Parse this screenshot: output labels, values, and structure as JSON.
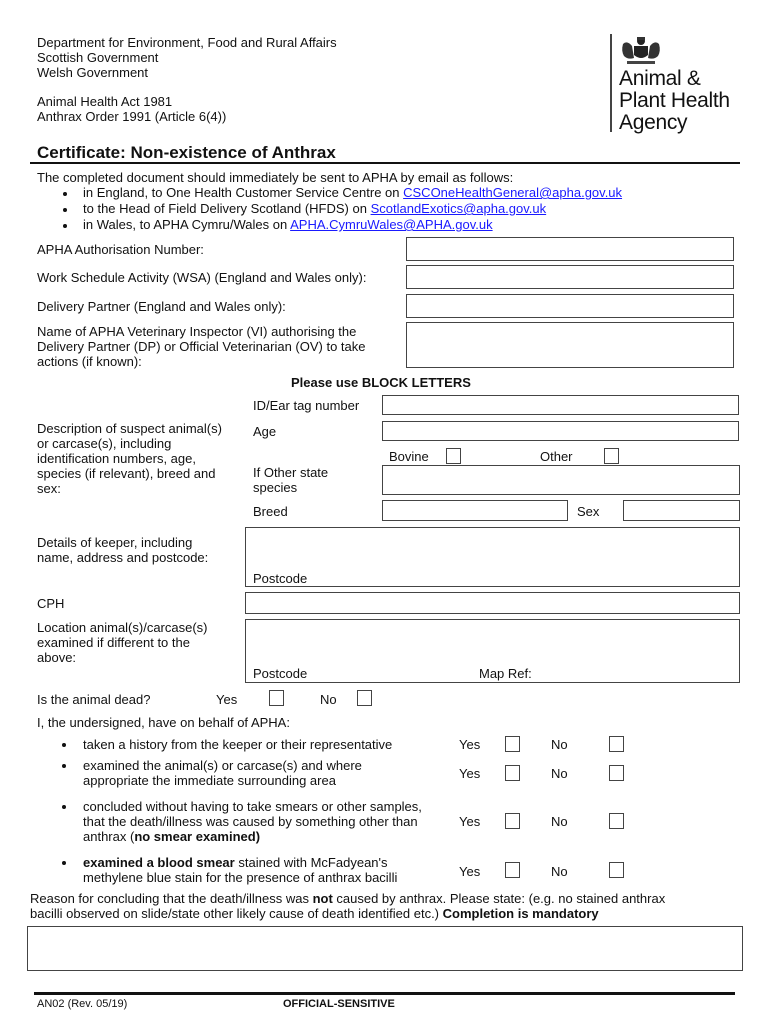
{
  "header": {
    "org_lines": [
      "Department for Environment, Food and Rural Affairs",
      "Scottish Government",
      "Welsh Government"
    ],
    "legislation_lines": [
      "Animal Health Act 1981",
      "Anthrax Order 1991 (Article 6(4))"
    ],
    "logo": {
      "icon": "royal-coat-of-arms-icon",
      "lines": [
        "Animal &",
        "Plant Health",
        "Agency"
      ]
    }
  },
  "title": "Certificate: Non-existence of Anthrax",
  "intro": {
    "text": "The completed document should immediately be sent to APHA by email as follows:",
    "bullets": [
      {
        "prefix": "in England, to One Health Customer Service Centre on ",
        "email": "CSCOneHealthGeneral@apha.gov.uk"
      },
      {
        "prefix": "to the Head of Field Delivery Scotland (HFDS) on ",
        "email": "ScotlandExotics@apha.gov.uk"
      },
      {
        "prefix": "in Wales, to APHA Cymru/Wales on ",
        "email": "APHA.CymruWales@APHA.gov.uk"
      }
    ],
    "link_color": "#1a1aff"
  },
  "fields": {
    "authorisation_number": {
      "label": "APHA Authorisation Number:",
      "value": ""
    },
    "wsa": {
      "label": "Work Schedule Activity (WSA) (England and Wales only):",
      "value": ""
    },
    "delivery_partner": {
      "label": "Delivery Partner (England and Wales only):",
      "value": ""
    },
    "vi_name": {
      "label_lines": [
        "Name of APHA Veterinary Inspector (VI) authorising the",
        "Delivery Partner (DP) or Official Veterinarian (OV) to take",
        "actions (if known):"
      ],
      "value": ""
    }
  },
  "block_letters_note": "Please use BLOCK LETTERS",
  "animal": {
    "description_lines": [
      "Description of suspect animal(s)",
      "or carcase(s), including",
      "identification numbers, age,",
      "species (if relevant), breed and",
      "sex:"
    ],
    "id_tag_label": "ID/Ear tag number",
    "age_label": "Age",
    "bovine_label": "Bovine",
    "other_label": "Other",
    "other_species_label_lines": [
      "If Other state",
      "species"
    ],
    "breed_label": "Breed",
    "sex_label": "Sex"
  },
  "keeper": {
    "label_lines": [
      "Details of keeper, including",
      "name, address and postcode:"
    ],
    "postcode_label": "Postcode"
  },
  "cph": {
    "label": "CPH",
    "value": ""
  },
  "location": {
    "label_lines": [
      "Location animal(s)/carcase(s)",
      "examined if different to the",
      "above:"
    ],
    "postcode_label": "Postcode",
    "map_ref_label": "Map Ref:"
  },
  "animal_dead": {
    "question": "Is the animal dead?",
    "yes_label": "Yes",
    "no_label": "No",
    "yes_checked": false,
    "no_checked": false
  },
  "declaration": {
    "intro": "I, the undersigned, have on behalf of APHA:",
    "items": [
      {
        "lines": [
          [
            {
              "t": "taken a history from the keeper or their representative",
              "b": false
            }
          ]
        ],
        "yes": "Yes",
        "no": "No",
        "yes_checked": false,
        "no_checked": false
      },
      {
        "lines": [
          [
            {
              "t": "examined the animal(s) or carcase(s) and where",
              "b": false
            }
          ],
          [
            {
              "t": "appropriate the immediate surrounding area",
              "b": false
            }
          ]
        ],
        "yes": "Yes",
        "no": "No",
        "yes_checked": false,
        "no_checked": false
      },
      {
        "lines": [
          [
            {
              "t": "concluded without having to take smears or other samples,",
              "b": false
            }
          ],
          [
            {
              "t": "that the death/illness was caused by something other than",
              "b": false
            }
          ],
          [
            {
              "t": "anthrax  (",
              "b": false
            },
            {
              "t": "no smear examined)",
              "b": true
            }
          ]
        ],
        "yes": "Yes",
        "no": "No",
        "yes_checked": false,
        "no_checked": false
      },
      {
        "lines": [
          [
            {
              "t": "examined a blood smear",
              "b": true
            },
            {
              "t": " stained with McFadyean's",
              "b": false
            }
          ],
          [
            {
              "t": "methylene blue stain for the presence of anthrax bacilli",
              "b": false
            }
          ]
        ],
        "yes": "Yes",
        "no": "No",
        "yes_checked": false,
        "no_checked": false
      }
    ]
  },
  "reason": {
    "line1_a": "Reason for concluding that the death/illness was ",
    "line1_bold": "not",
    "line1_b": " caused by anthrax. Please state: (e.g. no stained anthrax",
    "line2_a": "bacilli observed on slide/state other likely cause of death identified etc.) ",
    "line2_bold": "Completion is mandatory",
    "value": ""
  },
  "footer": {
    "form_code": "AN02 (Rev. 05/19)",
    "classification": "OFFICIAL-SENSITIVE"
  }
}
